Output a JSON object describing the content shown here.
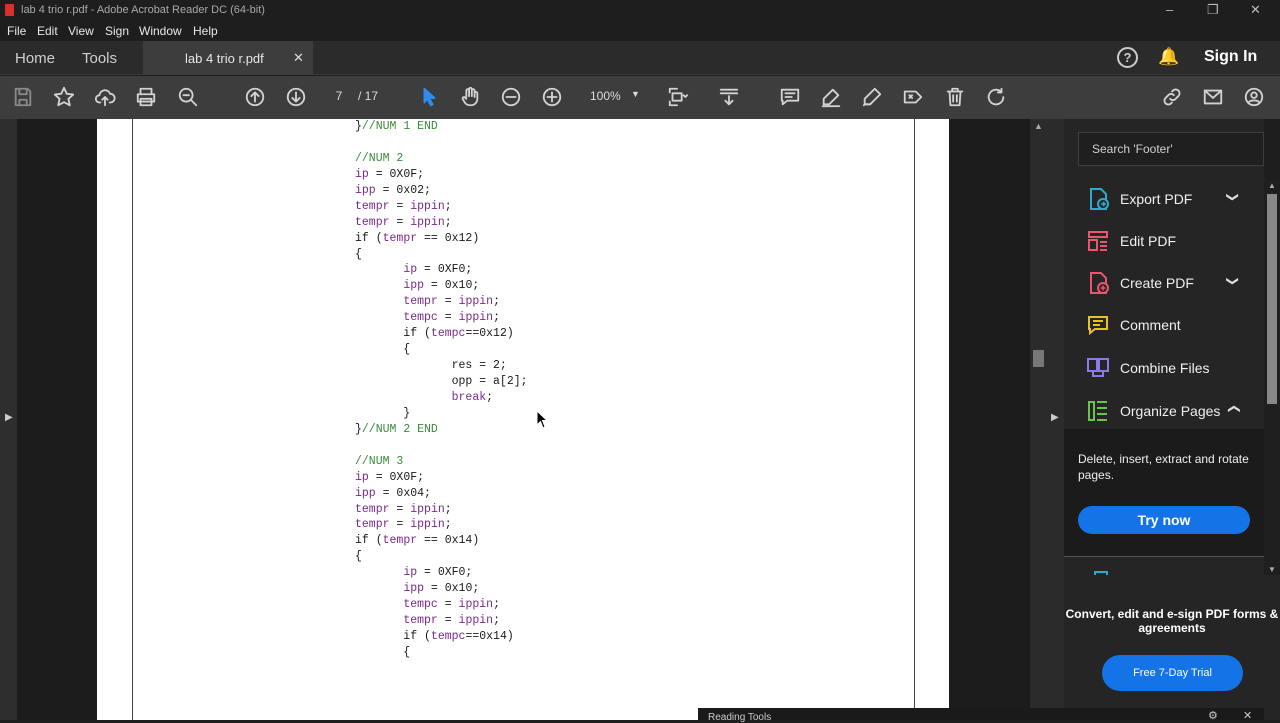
{
  "window": {
    "title": "lab 4 trio r.pdf - Adobe Acrobat Reader DC (64-bit)",
    "controls": [
      "–",
      "❐",
      "✕"
    ]
  },
  "menu": [
    "File",
    "Edit",
    "View",
    "Sign",
    "Window",
    "Help"
  ],
  "tabs": {
    "home": "Home",
    "tools": "Tools",
    "document": "lab 4 trio r.pdf",
    "close": "✕"
  },
  "header": {
    "help": "?",
    "sign_in": "Sign In"
  },
  "toolbar": {
    "current_page": "7",
    "total_pages": "/ 17",
    "zoom": "100%"
  },
  "document": {
    "lines": [
      [
        [
          "}",
          "kw"
        ],
        [
          "//NUM 1 END",
          "cm"
        ]
      ],
      [],
      [
        [
          "//NUM 2",
          "cm"
        ]
      ],
      [
        [
          "ip",
          "var"
        ],
        [
          " = 0X0F;",
          "kw"
        ]
      ],
      [
        [
          "ipp",
          "var"
        ],
        [
          " = 0x02;",
          "kw"
        ]
      ],
      [
        [
          "tempr",
          "var"
        ],
        [
          " = ",
          "kw"
        ],
        [
          "ippin",
          "var"
        ],
        [
          ";",
          "kw"
        ]
      ],
      [
        [
          "tempr",
          "var"
        ],
        [
          " = ",
          "kw"
        ],
        [
          "ippin",
          "var"
        ],
        [
          ";",
          "kw"
        ]
      ],
      [
        [
          "if (",
          "kw"
        ],
        [
          "tempr",
          "var"
        ],
        [
          " == 0x12)",
          "kw"
        ]
      ],
      [
        [
          "{",
          "kw"
        ]
      ],
      [
        [
          "       ",
          "kw"
        ],
        [
          "ip",
          "var"
        ],
        [
          " = 0XF0;",
          "kw"
        ]
      ],
      [
        [
          "       ",
          "kw"
        ],
        [
          "ipp",
          "var"
        ],
        [
          " = 0x10;",
          "kw"
        ]
      ],
      [
        [
          "       ",
          "kw"
        ],
        [
          "tempr",
          "var"
        ],
        [
          " = ",
          "kw"
        ],
        [
          "ippin",
          "var"
        ],
        [
          ";",
          "kw"
        ]
      ],
      [
        [
          "       ",
          "kw"
        ],
        [
          "tempc",
          "var"
        ],
        [
          " = ",
          "kw"
        ],
        [
          "ippin",
          "var"
        ],
        [
          ";",
          "kw"
        ]
      ],
      [
        [
          "       if (",
          "kw"
        ],
        [
          "tempc",
          "var"
        ],
        [
          "==0x12)",
          "kw"
        ]
      ],
      [
        [
          "       {",
          "kw"
        ]
      ],
      [
        [
          "              res = 2;",
          "kw"
        ]
      ],
      [
        [
          "              opp = a[2];",
          "kw"
        ]
      ],
      [
        [
          "              ",
          "kw"
        ],
        [
          "break",
          "var"
        ],
        [
          ";",
          "kw"
        ]
      ],
      [
        [
          "       }",
          "kw"
        ]
      ],
      [
        [
          "}",
          "kw"
        ],
        [
          "//NUM 2 END",
          "cm"
        ]
      ],
      [],
      [
        [
          "//NUM 3",
          "cm"
        ]
      ],
      [
        [
          "ip",
          "var"
        ],
        [
          " = 0X0F;",
          "kw"
        ]
      ],
      [
        [
          "ipp",
          "var"
        ],
        [
          " = 0x04;",
          "kw"
        ]
      ],
      [
        [
          "tempr",
          "var"
        ],
        [
          " = ",
          "kw"
        ],
        [
          "ippin",
          "var"
        ],
        [
          ";",
          "kw"
        ]
      ],
      [
        [
          "tempr",
          "var"
        ],
        [
          " = ",
          "kw"
        ],
        [
          "ippin",
          "var"
        ],
        [
          ";",
          "kw"
        ]
      ],
      [
        [
          "if (",
          "kw"
        ],
        [
          "tempr",
          "var"
        ],
        [
          " == 0x14)",
          "kw"
        ]
      ],
      [
        [
          "{",
          "kw"
        ]
      ],
      [
        [
          "       ",
          "kw"
        ],
        [
          "ip",
          "var"
        ],
        [
          " = 0XF0;",
          "kw"
        ]
      ],
      [
        [
          "       ",
          "kw"
        ],
        [
          "ipp",
          "var"
        ],
        [
          " = 0x10;",
          "kw"
        ]
      ],
      [
        [
          "       ",
          "kw"
        ],
        [
          "tempc",
          "var"
        ],
        [
          " = ",
          "kw"
        ],
        [
          "ippin",
          "var"
        ],
        [
          ";",
          "kw"
        ]
      ],
      [
        [
          "       ",
          "kw"
        ],
        [
          "tempr",
          "var"
        ],
        [
          " = ",
          "kw"
        ],
        [
          "ippin",
          "var"
        ],
        [
          ";",
          "kw"
        ]
      ],
      [
        [
          "       if (",
          "kw"
        ],
        [
          "tempc",
          "var"
        ],
        [
          "==0x14)",
          "kw"
        ]
      ],
      [
        [
          "       {",
          "kw"
        ]
      ]
    ]
  },
  "right_panel": {
    "search_placeholder": "Search 'Footer'",
    "tools": [
      {
        "label": "Export PDF",
        "icon": "export-pdf-icon",
        "chevron": "❯"
      },
      {
        "label": "Edit PDF",
        "icon": "edit-pdf-icon"
      },
      {
        "label": "Create PDF",
        "icon": "create-pdf-icon",
        "chevron": "❯"
      },
      {
        "label": "Comment",
        "icon": "comment-icon"
      },
      {
        "label": "Combine Files",
        "icon": "combine-files-icon"
      },
      {
        "label": "Organize Pages",
        "icon": "organize-pages-icon",
        "chevron": "❯"
      }
    ],
    "organize_description": "Delete, insert, extract and rotate pages.",
    "try_now": "Try now",
    "promo_text": "Convert, edit and e-sign PDF forms & agreements",
    "trial_button": "Free 7-Day Trial"
  },
  "toast": {
    "text": "Reading Tools"
  },
  "colors": {
    "accent": "#1473e6",
    "comment_green": "#3b8a3b",
    "variable_purple": "#7a2a8a"
  }
}
